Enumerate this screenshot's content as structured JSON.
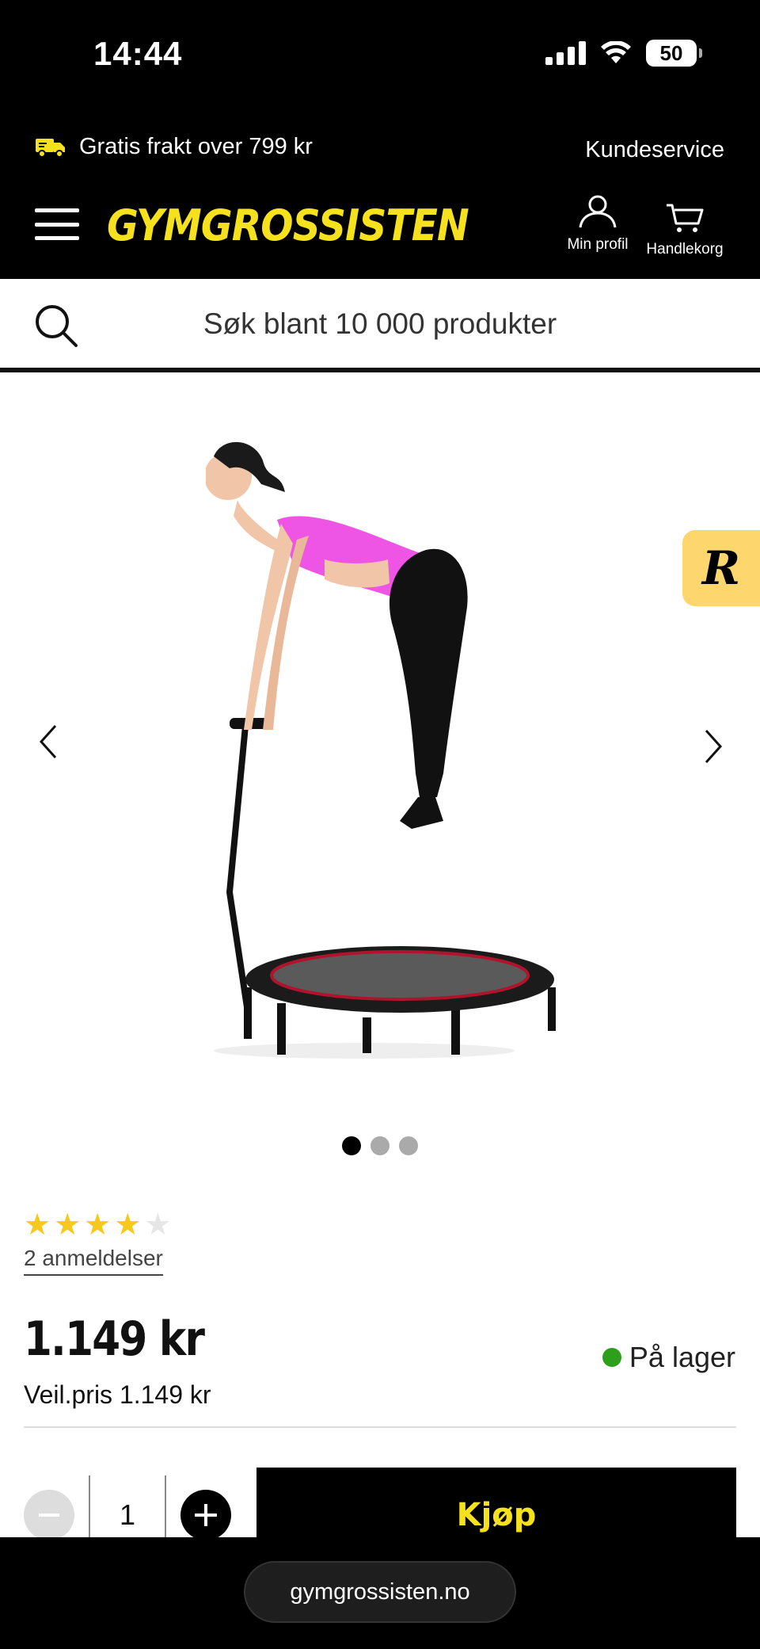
{
  "status_bar": {
    "time": "14:44",
    "battery": "50"
  },
  "header": {
    "promo_text": "Gratis frakt over 799 kr",
    "customer_service": "Kundeservice",
    "logo": "GYMGROSSISTEN",
    "profile_label": "Min profil",
    "cart_label": "Handlekorg",
    "accent_color": "#f5e21c"
  },
  "search": {
    "placeholder": "Søk blant 10 000 produkter"
  },
  "gallery": {
    "image_count": 3,
    "active_index": 0,
    "side_badge": "R"
  },
  "product": {
    "rating_stars": 4,
    "rating_max": 5,
    "reviews_text": "2 anmeldelser",
    "price": "1.149 kr",
    "recommended_price": "Veil.pris 1.149 kr",
    "stock_status": "På lager",
    "stock_color": "#2ca01c"
  },
  "purchase": {
    "quantity": "1",
    "buy_label": "Kjøp"
  },
  "browser": {
    "url": "gymgrossisten.no"
  }
}
